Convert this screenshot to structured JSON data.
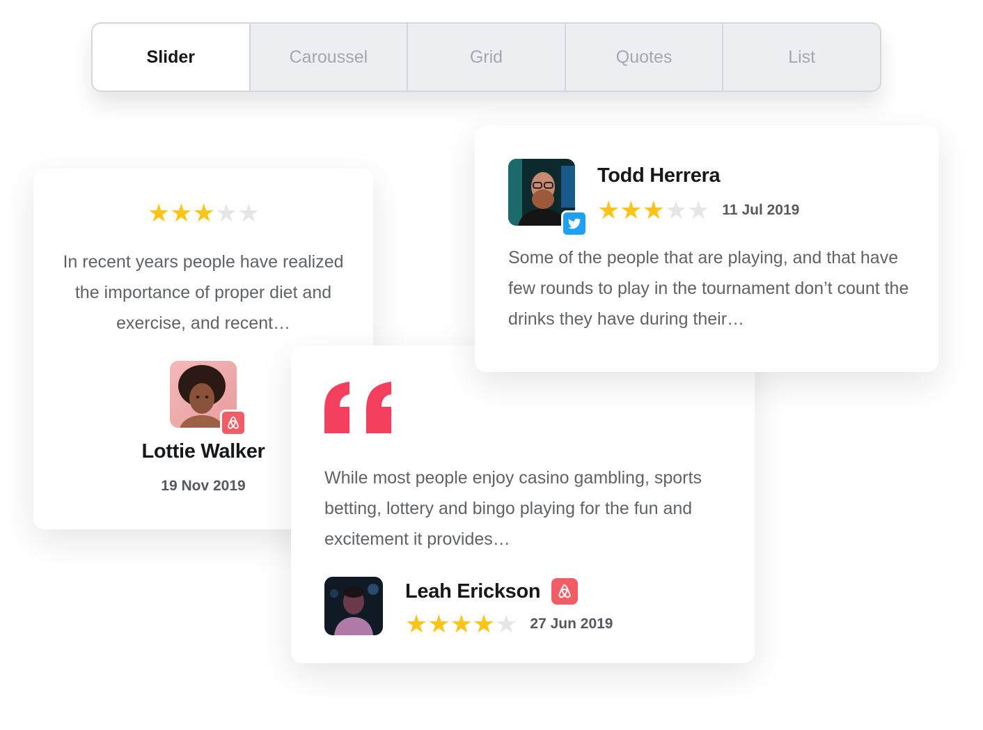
{
  "tabs": [
    {
      "label": "Slider",
      "active": true
    },
    {
      "label": "Caroussel",
      "active": false
    },
    {
      "label": "Grid",
      "active": false
    },
    {
      "label": "Quotes",
      "active": false
    },
    {
      "label": "List",
      "active": false
    }
  ],
  "reviews": {
    "lottie": {
      "name": "Lottie Walker",
      "date": "19 Nov 2019",
      "rating": 3,
      "max_rating": 5,
      "text": "In recent years people have realized the importance of proper diet and exercise, and recent…",
      "source_icon": "airbnb-icon"
    },
    "todd": {
      "name": "Todd Herrera",
      "date": "11 Jul 2019",
      "rating": 3,
      "max_rating": 5,
      "text": "Some of the people that are playing, and that have few rounds to play in the tournament don’t count the drinks they have during their…",
      "source_icon": "twitter-icon"
    },
    "leah": {
      "name": "Leah Erickson",
      "date": "27 Jun 2019",
      "rating": 4,
      "max_rating": 5,
      "text": "While most people enjoy casino gambling, sports betting, lottery and bingo playing for the fun and excitement it provides…",
      "source_icon": "airbnb-icon"
    }
  },
  "colors": {
    "star_on": "#fcc419",
    "star_off": "#e6e6e6",
    "quote_mark": "#f43f5e",
    "airbnb": "#f25c65",
    "twitter": "#1ea1f2"
  }
}
